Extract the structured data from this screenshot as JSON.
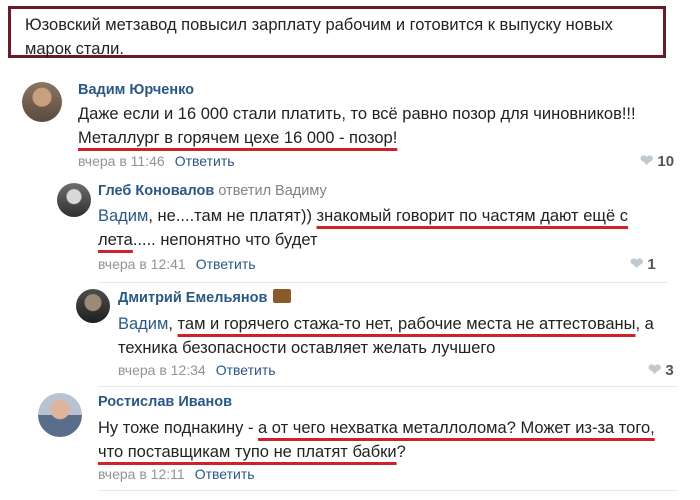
{
  "post": {
    "headline": "Юзовский метзавод повысил зарплату рабочим и готовится к выпуску новых марок стали."
  },
  "comments": [
    {
      "author": "Вадим Юрченко",
      "text_1": "Даже если и 16 000 стали платить, то всё равно позор для чиновников!!!",
      "text_2": "Металлург в горячем цехе 16 000 - позор!",
      "time": "вчера в 11:46",
      "reply_label": "Ответить",
      "likes": "10"
    },
    {
      "author": "Глеб Коновалов",
      "reply_note": "ответил Вадиму",
      "mention": "Вадим",
      "text_1": ", не....там не платят)) ",
      "text_2": "знакомый говорит по частям дают ещё с",
      "text_3": "лета",
      "text_4": "..... непонятно что будет",
      "time": "вчера в 12:41",
      "reply_label": "Ответить",
      "likes": "1"
    },
    {
      "author": "Дмитрий Емельянов",
      "mention": "Вадим",
      "text_1": ", ",
      "text_2": "там и горячего стажа-то нет, рабочие места не аттестованы",
      "text_3": ", а",
      "text_4": "техника безопасности оставляет желать лучшего",
      "time": "вчера в 12:34",
      "reply_label": "Ответить",
      "likes": "3"
    },
    {
      "author": "Ростислав Иванов",
      "text_1": "Ну тоже поднакину - ",
      "text_2": "а от чего нехватка металлолома? Может из-за того,",
      "text_3": "что поставщикам тупо не платят бабки",
      "text_4": "?",
      "time": "вчера в 12:11",
      "reply_label": "Ответить"
    }
  ],
  "colors": {
    "accent": "#2a5885",
    "underline": "#d0202a",
    "frame": "#6b1a2a"
  },
  "icons": {
    "like": "heart-icon",
    "badge": "briefcase-icon"
  }
}
